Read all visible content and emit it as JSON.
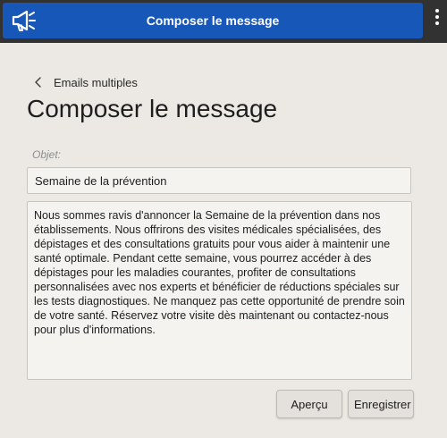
{
  "header": {
    "title": "Composer le message",
    "left_icon": "megaphone-icon",
    "right_icon": "more-vertical-icon",
    "color": "#1757b7"
  },
  "nav": {
    "back_label": "Emails multiples",
    "back_icon": "chevron-left-icon"
  },
  "page": {
    "title": "Composer le message"
  },
  "form": {
    "subject_label": "Objet:",
    "subject_value": "Semaine de la prévention",
    "body_value": "Nous sommes ravis d'annoncer la Semaine de la prévention dans nos établissements. Nous offrirons des visites médicales spécialisées, des dépistages et des consultations gratuits pour vous aider à maintenir une santé optimale. Pendant cette semaine, vous pourrez accéder à des dépistages pour les maladies courantes, profiter de consultations personnalisées avec nos experts et bénéficier de réductions spéciales sur les tests diagnostiques. Ne manquez pas cette opportunité de prendre soin de votre santé. Réservez votre visite dès maintenant ou contactez-nous pour plus d'informations."
  },
  "actions": {
    "preview_label": "Aperçu",
    "save_label": "Enregistrer"
  }
}
